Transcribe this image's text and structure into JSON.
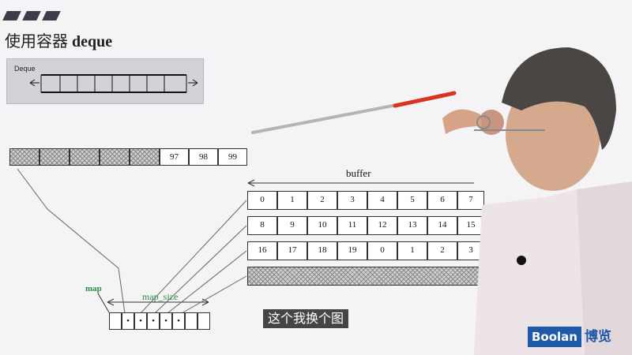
{
  "slide": {
    "title_cn": "使用容器",
    "title_en": "deque",
    "deque_label": "Deque",
    "buffer_label": "buffer",
    "map_label": "map",
    "map_size_label": "map_size",
    "top_row": [
      "97",
      "98",
      "99"
    ],
    "buffer_rows": [
      [
        "0",
        "1",
        "2",
        "3",
        "4",
        "5",
        "6",
        "7"
      ],
      [
        "8",
        "9",
        "10",
        "11",
        "12",
        "13",
        "14",
        "15"
      ],
      [
        "16",
        "17",
        "18",
        "19",
        "0",
        "1",
        "2",
        "3"
      ]
    ],
    "map_dots": [
      "•",
      "•",
      "•",
      "•",
      "•"
    ]
  },
  "subtitle": "这个我换个图",
  "logo": {
    "brand_en": "Boolan",
    "brand_cn": "博览"
  },
  "colors": {
    "pointer": "#d8341e",
    "logo": "#1e5aa8",
    "map_label": "#2e8a4a"
  }
}
